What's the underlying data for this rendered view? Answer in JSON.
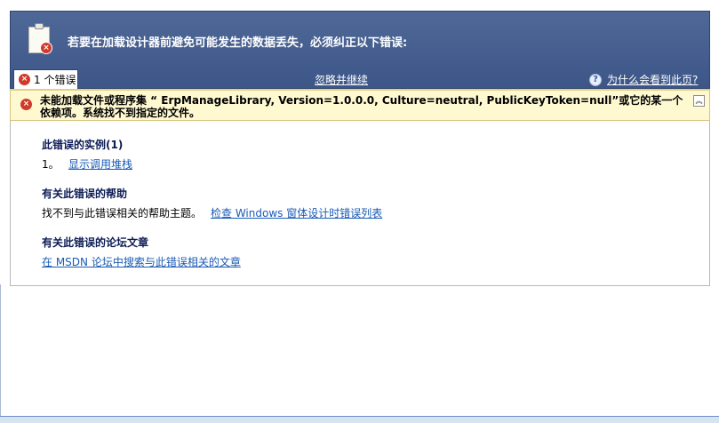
{
  "header": {
    "message": "若要在加载设计器前避免可能发生的数据丢失，必须纠正以下错误:"
  },
  "toolbar": {
    "tab_label": "1 个错误",
    "ignore_label": "忽略并继续",
    "help_label": "为什么会看到此页?"
  },
  "error": {
    "message": "未能加载文件或程序集 “ ErpManageLibrary, Version=1.0.0.0, Culture=neutral, PublicKeyToken=null”或它的某一个依赖项。系统找不到指定的文件。"
  },
  "sections": {
    "instances": {
      "title": "此错误的实例(1)",
      "item_number": "1。",
      "item_link": "显示调用堆栈"
    },
    "help": {
      "title": "有关此错误的帮助",
      "text": "找不到与此错误相关的帮助主题。",
      "link": "检查  Windows 窗体设计时错误列表"
    },
    "forum": {
      "title": "有关此错误的论坛文章",
      "link": "在  MSDN 论坛中搜索与此错误相关的文章"
    }
  },
  "colors": {
    "header_bg": "#4e6897",
    "banner_bg": "#fff9d2",
    "link": "#1a5bb5",
    "error_icon": "#d03a2a"
  }
}
